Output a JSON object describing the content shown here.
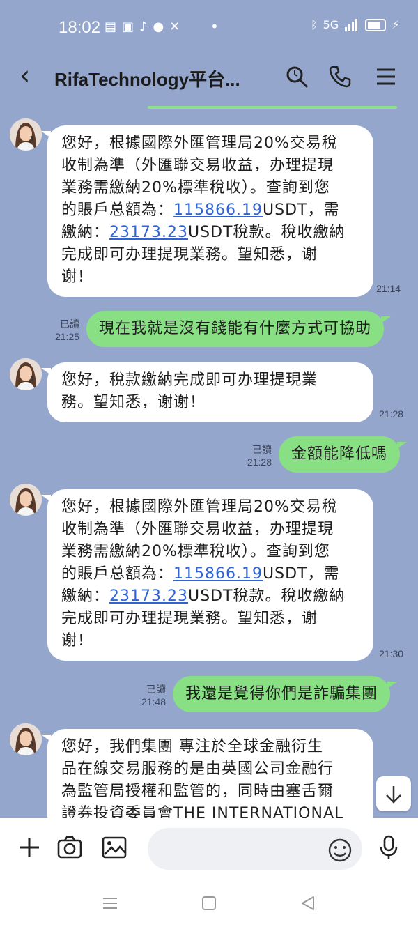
{
  "status": {
    "time": "18:02",
    "network": "5G"
  },
  "header": {
    "title": "RifaTechnology平台..."
  },
  "messages": {
    "m1": {
      "l1": "您好，根據國際外匯管理局20%交易稅",
      "l2": "收制為準（外匯聯交易收益，办理提現",
      "l3": "業務需繳納20%標準稅收）。查詢到您",
      "l4a": "的賬戶总額為：",
      "l4b": "115866.19",
      "l4c": "USDT，需",
      "l5a": "繳納：",
      "l5b": "23173.23",
      "l5c": "USDT稅款。稅收繳納",
      "l6": "完成即可办理提現業務。望知悉，谢",
      "l7": "谢！",
      "time": "21:14"
    },
    "m2": {
      "text": "現在我就是沒有錢能有什麼方式可協助",
      "read": "已讀",
      "time": "21:25"
    },
    "m3": {
      "l1": "您好，稅款繳納完成即可办理提現業",
      "l2": "務。望知悉，谢谢！",
      "time": "21:28"
    },
    "m4": {
      "text": "金額能降低嗎",
      "read": "已讀",
      "time": "21:28"
    },
    "m5": {
      "l1": "您好，根據國際外匯管理局20%交易稅",
      "l2": "收制為準（外匯聯交易收益，办理提現",
      "l3": "業務需繳納20%標準稅收）。查詢到您",
      "l4a": "的賬戶总額為：",
      "l4b": "115866.19",
      "l4c": "USDT，需",
      "l5a": "繳納：",
      "l5b": "23173.23",
      "l5c": "USDT稅款。稅收繳納",
      "l6": "完成即可办理提現業務。望知悉，谢",
      "l7": "谢！",
      "time": "21:30"
    },
    "m6": {
      "text": "我還是覺得你們是詐騙集團",
      "read": "已讀",
      "time": "21:48"
    },
    "m7": {
      "l1": "您好，我們集團 專注於全球金融衍生",
      "l2": "品在線交易服務的是由英國公司金融行",
      "l3": "為監管局授權和監管的，同時由塞舌爾",
      "l4": "證券投資委員會THE INTERNATIONAL"
    }
  },
  "input": {
    "placeholder": ""
  },
  "colors": {
    "chat_bg": "#95a6cd",
    "outgoing_bubble": "#89e084",
    "incoming_bubble": "#ffffff",
    "link": "#2f64d6"
  }
}
